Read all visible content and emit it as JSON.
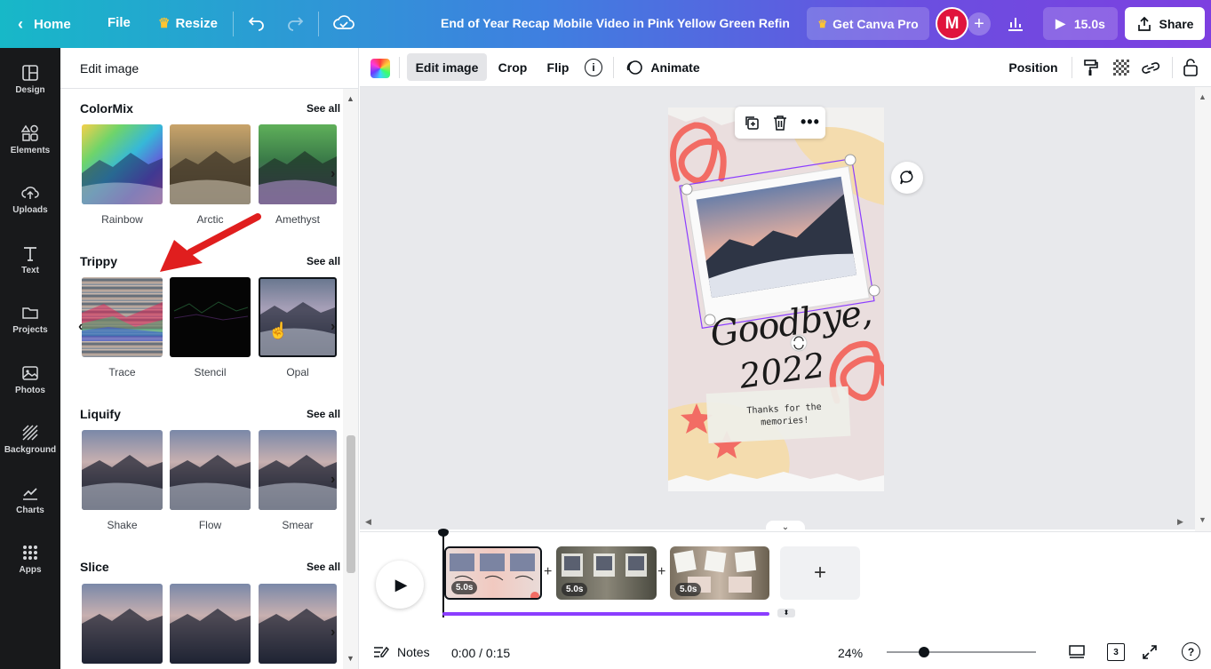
{
  "topbar": {
    "home": "Home",
    "file": "File",
    "resize": "Resize",
    "doc_title": "End of Year Recap Mobile Video in Pink Yellow Green Refine...",
    "get_pro": "Get Canva Pro",
    "avatar_letter": "M",
    "duration": "15.0s",
    "share": "Share"
  },
  "rail": [
    {
      "label": "Design",
      "icon": "design-icon"
    },
    {
      "label": "Elements",
      "icon": "elements-icon"
    },
    {
      "label": "Uploads",
      "icon": "uploads-icon"
    },
    {
      "label": "Text",
      "icon": "text-icon"
    },
    {
      "label": "Projects",
      "icon": "projects-icon"
    },
    {
      "label": "Photos",
      "icon": "photos-icon"
    },
    {
      "label": "Background",
      "icon": "background-icon"
    },
    {
      "label": "Charts",
      "icon": "charts-icon"
    },
    {
      "label": "Apps",
      "icon": "apps-icon"
    }
  ],
  "panel": {
    "title": "Edit image",
    "see_all": "See all",
    "sections": [
      {
        "title": "ColorMix",
        "items": [
          "Rainbow",
          "Arctic",
          "Amethyst"
        ]
      },
      {
        "title": "Trippy",
        "items": [
          "Trace",
          "Stencil",
          "Opal"
        ]
      },
      {
        "title": "Liquify",
        "items": [
          "Shake",
          "Flow",
          "Smear"
        ]
      },
      {
        "title": "Slice",
        "items": [
          "",
          "",
          ""
        ]
      }
    ]
  },
  "toolbar": {
    "edit_image": "Edit image",
    "crop": "Crop",
    "flip": "Flip",
    "animate": "Animate",
    "position": "Position"
  },
  "design": {
    "headline_1": "Goodbye,",
    "headline_2": "2022",
    "note": "Thanks for the memories!"
  },
  "timeline": {
    "clips": [
      "5.0s",
      "5.0s",
      "5.0s"
    ],
    "add": "+"
  },
  "footer": {
    "notes": "Notes",
    "time": "0:00 / 0:15",
    "zoom": "24%",
    "pages": "3",
    "help": "?"
  },
  "colors": {
    "accent": "#8b3dff",
    "rail_bg": "#18191b",
    "arrow": "#e01e1e"
  }
}
